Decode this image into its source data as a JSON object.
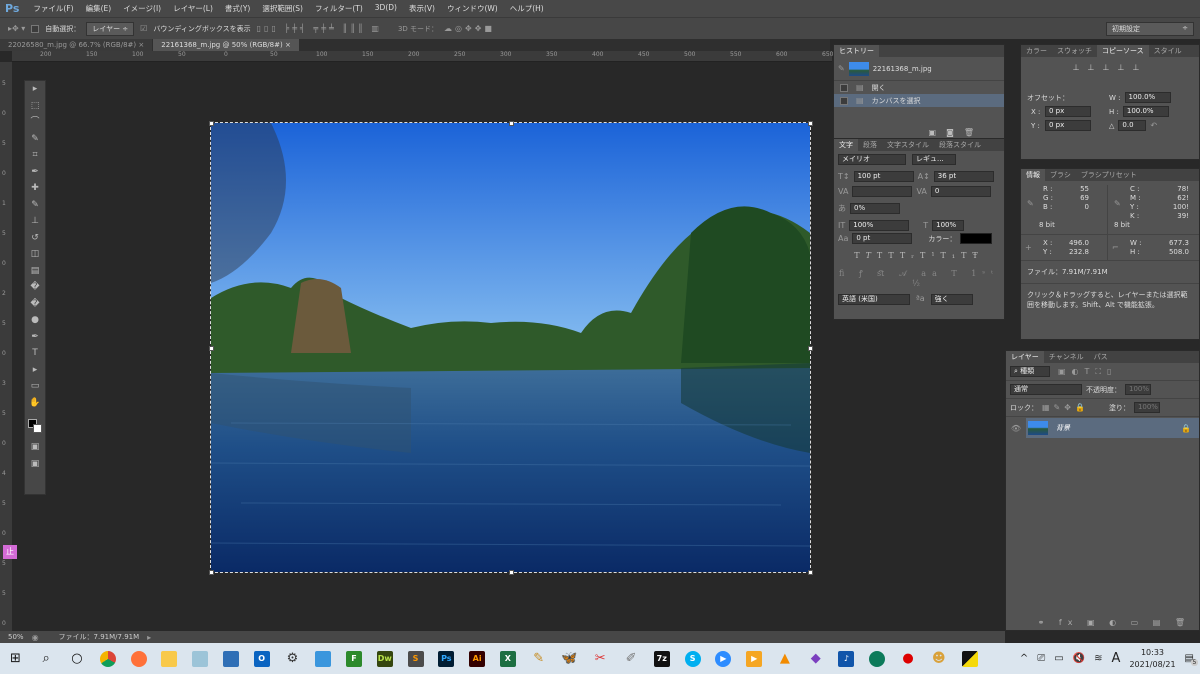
{
  "app": {
    "logo": "Ps"
  },
  "menu": [
    "ファイル(F)",
    "編集(E)",
    "イメージ(I)",
    "レイヤー(L)",
    "書式(Y)",
    "選択範囲(S)",
    "フィルター(T)",
    "3D(D)",
    "表示(V)",
    "ウィンドウ(W)",
    "ヘルプ(H)"
  ],
  "options": {
    "auto_select_label": "自動選択：",
    "auto_select_value": "レイヤー",
    "bounding_box_label": "バウンディングボックスを表示",
    "mode3d_label": "3D モード：",
    "workspace": "初期設定"
  },
  "doc_tabs": [
    {
      "label": "22026580_m.jpg @ 66.7% (RGB/8#)",
      "active": false
    },
    {
      "label": "22161368_m.jpg @ 50% (RGB/8#)",
      "active": true
    }
  ],
  "ruler_labels": [
    "200",
    "150",
    "100",
    "50",
    "0",
    "50",
    "100",
    "150",
    "200",
    "250",
    "300",
    "350",
    "400",
    "450",
    "500",
    "550",
    "600",
    "650"
  ],
  "vruler_labels": [
    "5",
    "0",
    "5",
    "0",
    "1",
    "5",
    "0",
    "2",
    "5",
    "0",
    "3",
    "5",
    "0",
    "4",
    "5",
    "0",
    "5",
    "5",
    "0"
  ],
  "history": {
    "tab": "ヒストリー",
    "snapshot": "22161368_m.jpg",
    "items": [
      "開く",
      "カンバスを選択"
    ]
  },
  "character": {
    "tabs": [
      "文字",
      "段落",
      "文字スタイル",
      "段落スタイル"
    ],
    "font": "メイリオ",
    "style": "レギュ...",
    "size": "100 pt",
    "leading": "36 pt",
    "kerning": "",
    "tracking": "0",
    "tsume": "0%",
    "vscale": "100%",
    "hscale": "100%",
    "baseline": "0 pt",
    "color_label": "カラー：",
    "language": "英語 (米国)",
    "aa": "強く"
  },
  "clone": {
    "tabs": [
      "カラー",
      "スウォッチ",
      "コピーソース",
      "スタイル"
    ],
    "offset_label": "オフセット：",
    "x": "0 px",
    "y": "0 px",
    "w": "100.0%",
    "h": "100.0%",
    "angle": "0.0"
  },
  "info": {
    "tabs": [
      "情報",
      "ブラシ",
      "ブラシプリセット"
    ],
    "R": "55",
    "G": "69",
    "B": "0",
    "C": "78!",
    "M": "62!",
    "Y": "100!",
    "K": "39!",
    "bits": "8 bit",
    "X": "496.0",
    "Yc": "232.8",
    "W": "677.3",
    "H": "508.0",
    "file": "ファイル：7.91M/7.91M",
    "hint": "クリック＆ドラッグすると、レイヤーまたは選択範囲を移動します。Shift、Alt で機能拡張。"
  },
  "layers": {
    "tabs": [
      "レイヤー",
      "チャンネル",
      "パス"
    ],
    "filter": "種類",
    "blend": "通常",
    "opacity_label": "不透明度：",
    "opacity": "100%",
    "lock_label": "ロック：",
    "fill_label": "塗り：",
    "fill": "100%",
    "items": [
      {
        "name": "背景"
      }
    ]
  },
  "status": {
    "zoom": "50%",
    "file": "ファイル：7.91M/7.91M"
  },
  "taskbar": {
    "time": "10:33",
    "date": "2021/08/21",
    "notif": "5",
    "ime": "A"
  },
  "colors": {
    "accent": "#6fa8dc",
    "panel": "#535353",
    "selected": "#5b6b7f"
  }
}
